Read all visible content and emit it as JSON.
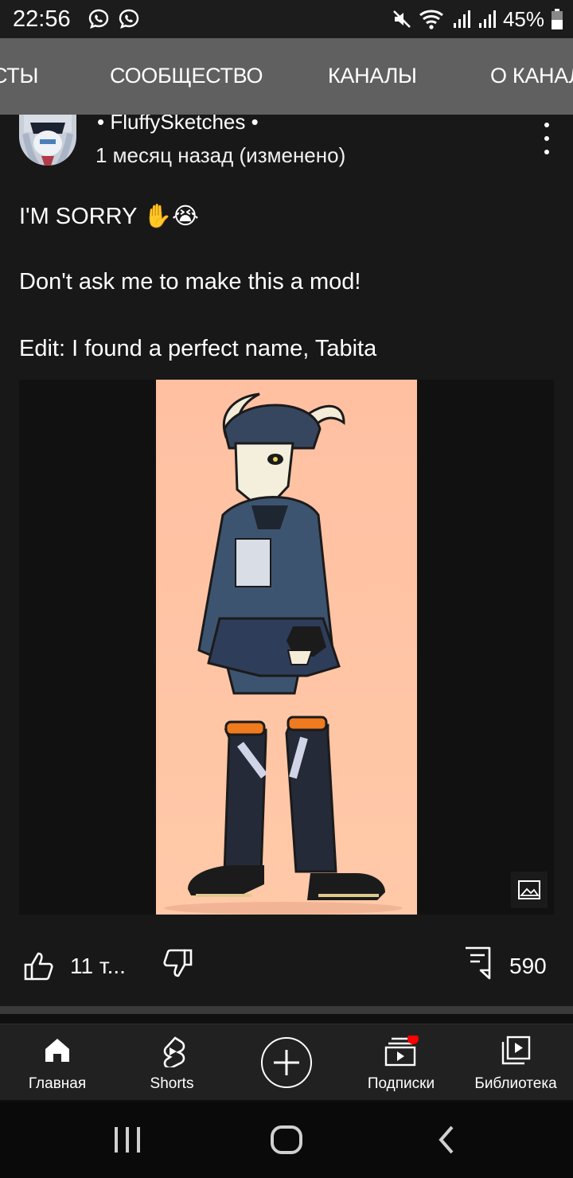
{
  "status_bar": {
    "time": "22:56",
    "battery_percent": "45%",
    "icons": [
      "viber-icon",
      "viber-icon",
      "mute-icon",
      "wifi-icon",
      "signal-icon",
      "signal-icon",
      "battery-icon"
    ]
  },
  "tabs": [
    {
      "label": "СТЫ",
      "selected": false
    },
    {
      "label": "СООБЩЕСТВО",
      "selected": true
    },
    {
      "label": "КАНАЛЫ",
      "selected": false
    },
    {
      "label": "О КАНАЛЕ",
      "selected": false
    }
  ],
  "post": {
    "author": "• FluffySketches •",
    "time": "1 месяц назад (изменено)",
    "lines": [
      "I'M SORRY ✋😭",
      "Don't ask me to make this a mod!",
      "Edit: I found a perfect name, Tabita"
    ],
    "likes": "11 т...",
    "comments": "590"
  },
  "bottom_nav": {
    "items": [
      {
        "label": "Главная",
        "icon": "home-icon"
      },
      {
        "label": "Shorts",
        "icon": "shorts-icon"
      },
      {
        "label": "",
        "icon": "create-icon"
      },
      {
        "label": "Подписки",
        "icon": "subscriptions-icon"
      },
      {
        "label": "Библиотека",
        "icon": "library-icon"
      }
    ],
    "subscriptions_badge_color": "#ff0000"
  },
  "colors": {
    "tab_bar": "#606060",
    "post_bg": "#181818",
    "art_bg": "#ffc2a0"
  }
}
